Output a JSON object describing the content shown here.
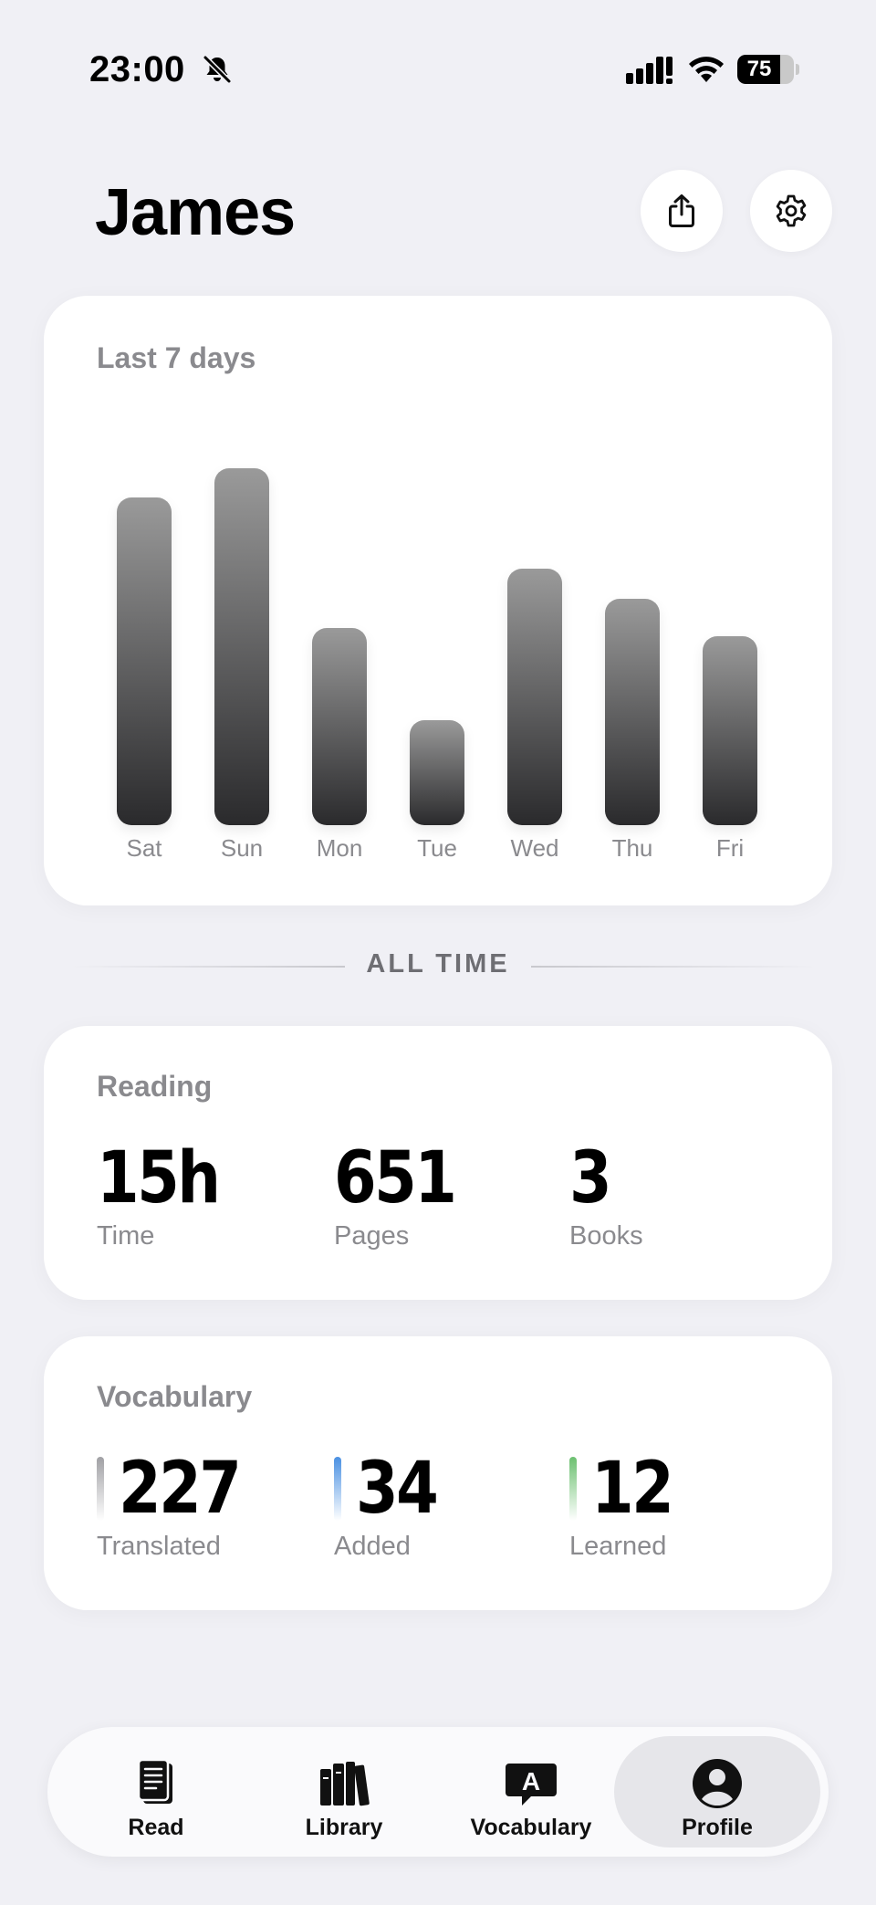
{
  "status_bar": {
    "time": "23:00",
    "battery_level": "75",
    "battery_fraction": 0.75,
    "icons": [
      "bell-slash-icon",
      "cellular-signal-icon",
      "wifi-icon",
      "battery-icon"
    ]
  },
  "header": {
    "title": "James",
    "actions": [
      {
        "name": "share",
        "icon": "share-icon"
      },
      {
        "name": "settings",
        "icon": "gear-icon"
      }
    ]
  },
  "weekly_card": {
    "label": "Last 7 days"
  },
  "chart_data": {
    "type": "bar",
    "title": "Last 7 days",
    "categories": [
      "Sat",
      "Sun",
      "Mon",
      "Tue",
      "Wed",
      "Thu",
      "Fri"
    ],
    "values": [
      78,
      85,
      47,
      25,
      61,
      54,
      45
    ],
    "ylim": [
      0,
      100
    ],
    "grid": false,
    "colors": {
      "top": "#9a9a9a",
      "bottom": "#2a2a2c"
    }
  },
  "divider": {
    "label": "ALL TIME"
  },
  "reading": {
    "label": "Reading",
    "stats": [
      {
        "value": "15h",
        "label": "Time"
      },
      {
        "value": "651",
        "label": "Pages"
      },
      {
        "value": "3",
        "label": "Books"
      }
    ]
  },
  "vocabulary": {
    "label": "Vocabulary",
    "stats": [
      {
        "value": "227",
        "label": "Translated",
        "color": "#a0a0a4"
      },
      {
        "value": "34",
        "label": "Added",
        "color": "#4a90e2"
      },
      {
        "value": "12",
        "label": "Learned",
        "color": "#6cc070"
      }
    ]
  },
  "tab_bar": {
    "tabs": [
      {
        "label": "Read",
        "icon": "book-icon",
        "active": false
      },
      {
        "label": "Library",
        "icon": "books-icon",
        "active": false
      },
      {
        "label": "Vocabulary",
        "icon": "translate-bubble-icon",
        "active": false
      },
      {
        "label": "Profile",
        "icon": "person-circle-icon",
        "active": true
      }
    ]
  }
}
